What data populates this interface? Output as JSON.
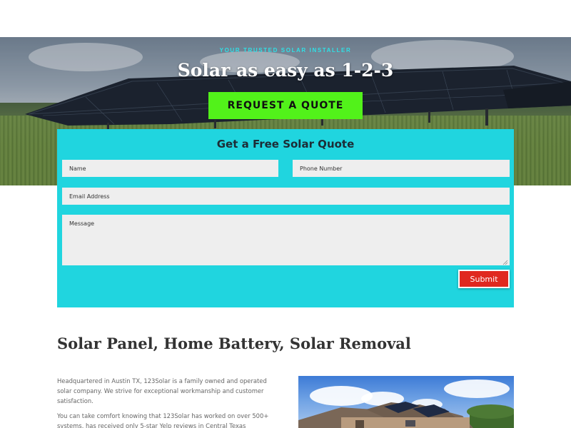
{
  "hero": {
    "eyebrow": "YOUR TRUSTED SOLAR INSTALLER",
    "title": "Solar as easy as 1-2-3",
    "cta_label": "REQUEST A QUOTE"
  },
  "form": {
    "title": "Get a Free Solar Quote",
    "name_placeholder": "Name",
    "phone_placeholder": "Phone Number",
    "email_placeholder": "Email Address",
    "message_placeholder": "Message",
    "submit_label": "Submit"
  },
  "about": {
    "heading": "Solar Panel, Home Battery, Solar Removal",
    "paragraph_1": "Headquartered in Austin TX, 123Solar is a family owned and operated solar company. We strive for exceptional workmanship and customer satisfaction.",
    "paragraph_2": "You can take comfort knowing that 123Solar has worked on over 500+ systems, has received only 5-star Yelp reviews in Central Texas"
  },
  "colors": {
    "accent_cyan": "#20d5df",
    "cta_green": "#52f21a",
    "submit_red": "#e0281f"
  },
  "icons": {
    "resize_grip": "resize-grip-icon"
  }
}
